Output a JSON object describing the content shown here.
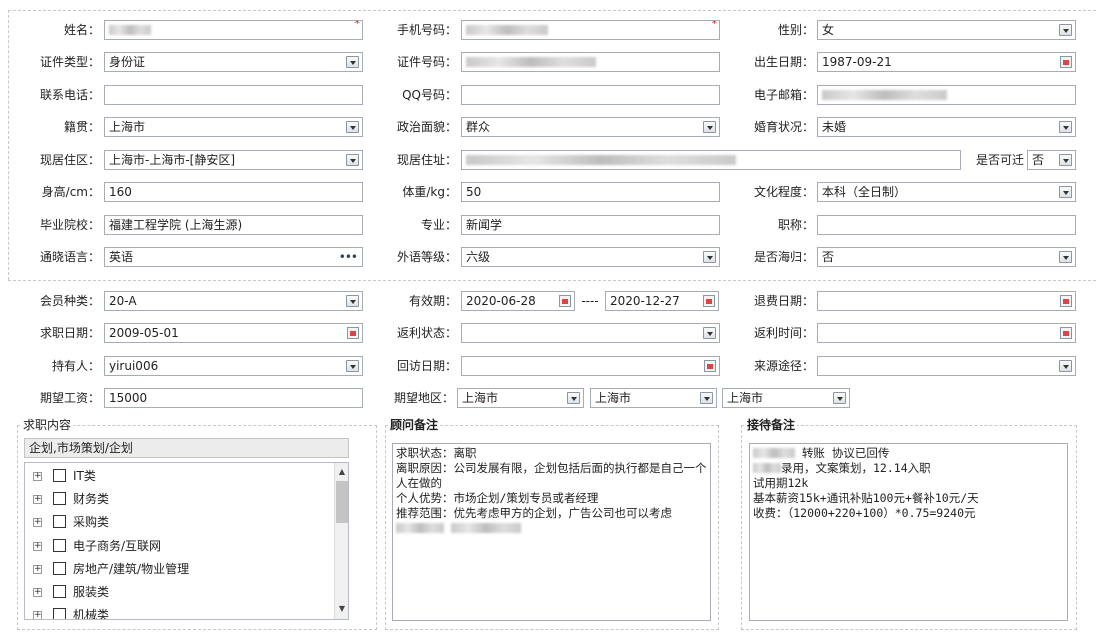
{
  "basic": {
    "name_label": "姓名：",
    "mobile_label": "手机号码：",
    "gender_label": "性别：",
    "gender_value": "女",
    "id_type_label": "证件类型：",
    "id_type_value": "身份证",
    "id_no_label": "证件号码：",
    "birth_label": "出生日期：",
    "birth_value": "1987-09-21",
    "phone_label": "联系电话：",
    "qq_label": "QQ号码：",
    "email_label": "电子邮箱：",
    "native_label": "籍贯：",
    "native_value": "上海市",
    "political_label": "政治面貌：",
    "political_value": "群众",
    "marital_label": "婚育状况：",
    "marital_value": "未婚",
    "residence_label": "现居住区：",
    "residence_value": "上海市-上海市-[静安区]",
    "address_label": "现居住址：",
    "relocate_label": "是否可迁",
    "relocate_value": "否",
    "height_label": "身高/cm：",
    "height_value": "160",
    "weight_label": "体重/kg：",
    "weight_value": "50",
    "education_label": "文化程度：",
    "education_value": "本科（全日制）",
    "school_label": "毕业院校：",
    "school_value": "福建工程学院 (上海生源)",
    "major_label": "专业：",
    "major_value": "新闻学",
    "title_label": "职称：",
    "language_label": "通晓语言：",
    "language_value": "英语",
    "lang_level_label": "外语等级：",
    "lang_level_value": "六级",
    "overseas_label": "是否海归：",
    "overseas_value": "否"
  },
  "member": {
    "type_label": "会员种类：",
    "type_value": "20-A",
    "valid_label": "有效期：",
    "valid_from": "2020-06-28",
    "valid_sep": "----",
    "valid_to": "2020-12-27",
    "refund_date_label": "退费日期：",
    "job_date_label": "求职日期：",
    "job_date_value": "2009-05-01",
    "rebate_status_label": "返利状态：",
    "rebate_time_label": "返利时间：",
    "holder_label": "持有人：",
    "holder_value": "yirui006",
    "visit_date_label": "回访日期：",
    "source_label": "来源途径：",
    "salary_label": "期望工资：",
    "salary_value": "15000",
    "area_label": "期望地区：",
    "area_1": "上海市",
    "area_2": "上海市",
    "area_3": "上海市"
  },
  "job_content": {
    "title": "求职内容",
    "selected": "企划,市场策划/企划",
    "items": [
      {
        "expander": "+",
        "label": "IT类"
      },
      {
        "expander": "+",
        "label": "财务类"
      },
      {
        "expander": "+",
        "label": "采购类"
      },
      {
        "expander": "+",
        "label": "电子商务/互联网"
      },
      {
        "expander": "+",
        "label": "房地产/建筑/物业管理"
      },
      {
        "expander": "+",
        "label": "服装类"
      },
      {
        "expander": "+",
        "label": "机械类"
      }
    ],
    "scroll_up": "▲",
    "scroll_down": "▼"
  },
  "consultant": {
    "title": "顾问备注",
    "text": "求职状态：离职\n离职原因：公司发展有限，企划包括后面的执行都是自己一个人在做的\n个人优势：市场企划/策划专员或者经理\n推荐范围：优先考虑甲方的企划，广告公司也可以考虑"
  },
  "reception": {
    "title": "接待备注",
    "line1": " 转账 协议已回传",
    "line2": "录用，文案策划，12.14入职",
    "line3": "试用期12k",
    "line4": "基本薪资15k+通讯补贴100元+餐补10元/天",
    "line5": "收费：（12000+220+100）*0.75=9240元"
  },
  "icons": {
    "required": "*",
    "more": "•••"
  }
}
